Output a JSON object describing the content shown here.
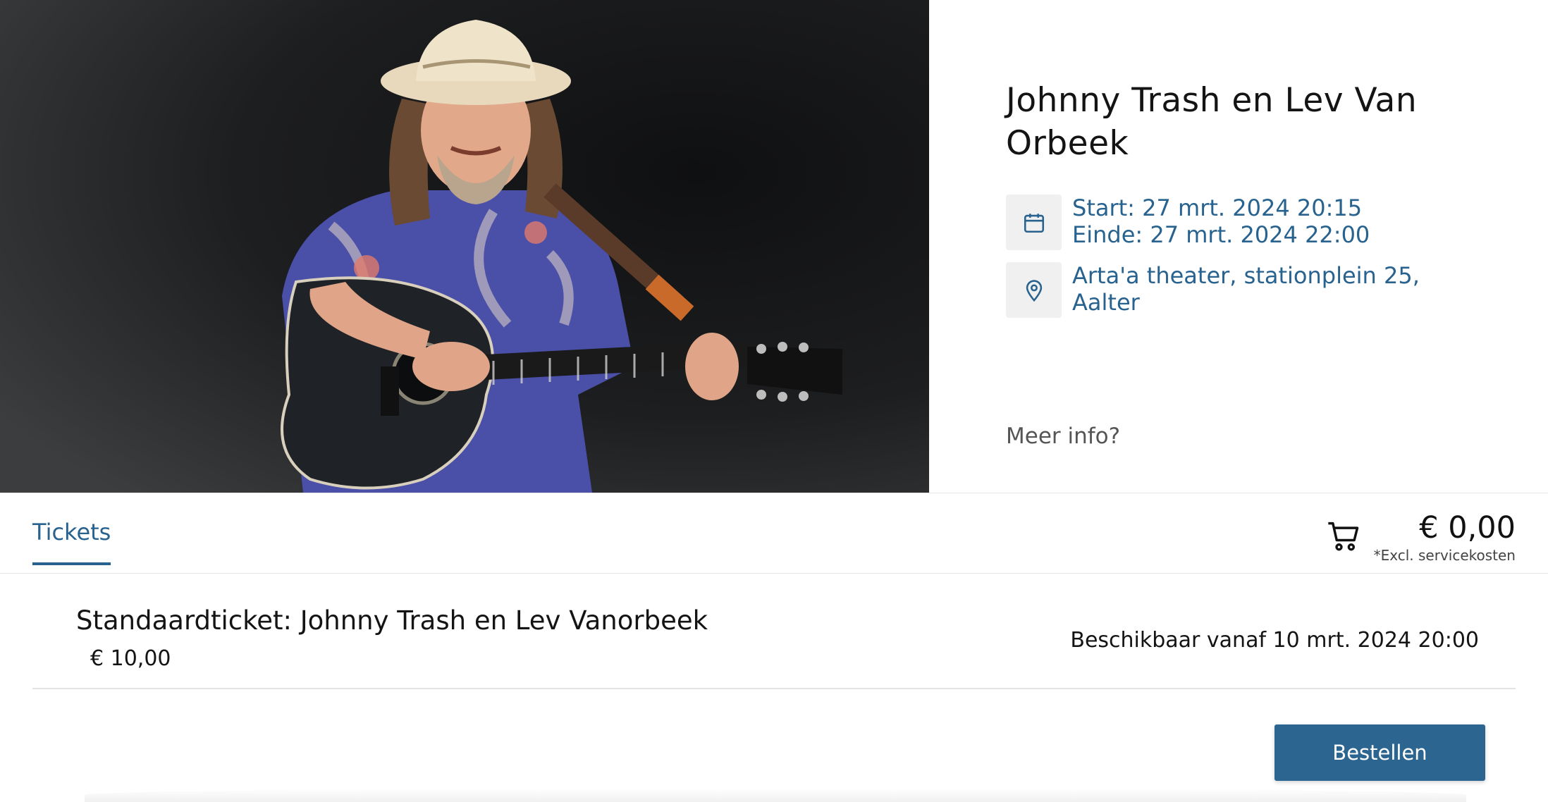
{
  "event": {
    "title": "Johnny Trash en Lev Van Orbeek",
    "start": "Start: 27 mrt. 2024 20:15",
    "end": "Einde: 27 mrt. 2024 22:00",
    "location_line1": "Arta'a theater, stationplein 25,",
    "location_line2": "Aalter",
    "more_info": "Meer info?"
  },
  "tabs": {
    "tickets_label": "Tickets"
  },
  "cart": {
    "total": "€ 0,00",
    "note": "*Excl. servicekosten"
  },
  "tickets": [
    {
      "name": "Standaardticket: Johnny Trash en Lev Vanorbeek",
      "price": "€ 10,00",
      "availability": "Beschikbaar vanaf 10 mrt. 2024 20:00"
    }
  ],
  "order_button_label": "Bestellen",
  "icons": {
    "calendar": "calendar-icon",
    "location": "map-pin-icon",
    "cart": "shopping-cart-icon"
  },
  "colors": {
    "accent": "#28628f",
    "button": "#2c6590"
  }
}
